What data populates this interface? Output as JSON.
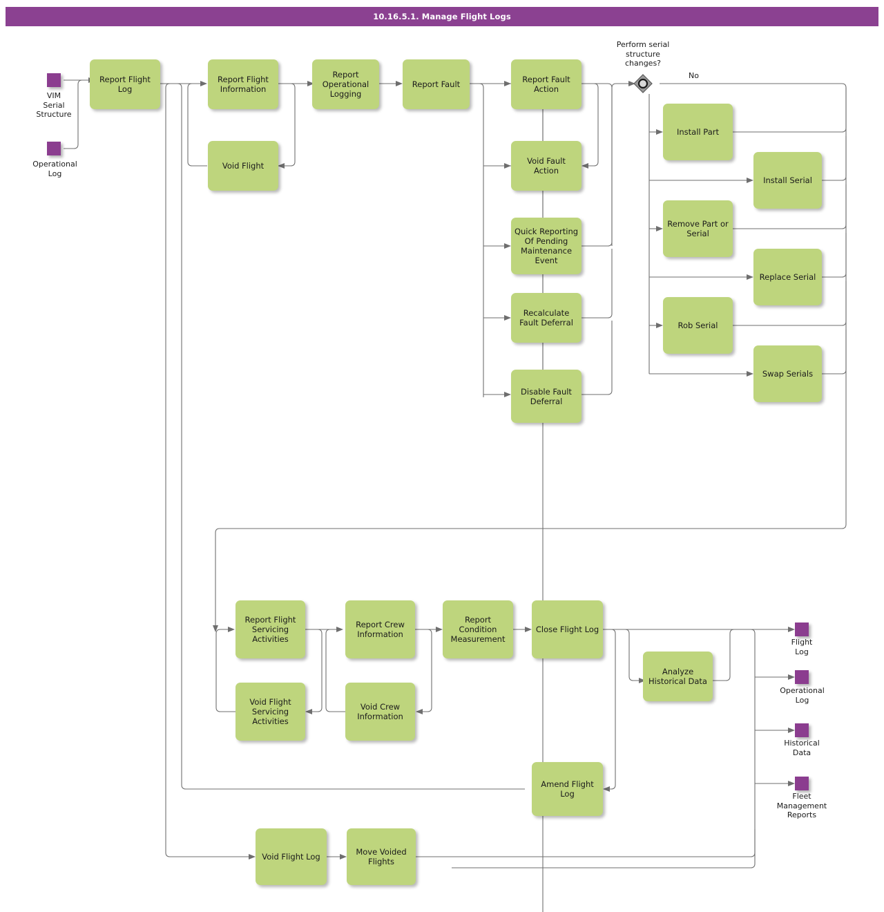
{
  "header": {
    "title": "10.16.5.1. Manage Flight Logs"
  },
  "colors": {
    "title_bar": "#8b4191",
    "process_box": "#bed57d",
    "terminator": "#8b3d8f",
    "connector": "#6e6e6e",
    "gateway_fill": "#8a8a8a"
  },
  "diagram": {
    "type": "flowchart",
    "terminators": [
      {
        "id": "t-vim-serial-structure",
        "label": "VIM\nSerial\nStructure",
        "label_lines": [
          "VIM",
          "Serial",
          "Structure"
        ]
      },
      {
        "id": "t-operational-log-in",
        "label": "Operational\nLog",
        "label_lines": [
          "Operational",
          "Log"
        ]
      },
      {
        "id": "t-flight-log-out",
        "label": "Flight\nLog",
        "label_lines": [
          "Flight",
          "Log"
        ]
      },
      {
        "id": "t-operational-log-out",
        "label": "Operational\nLog",
        "label_lines": [
          "Operational",
          "Log"
        ]
      },
      {
        "id": "t-historical-data-out",
        "label": "Historical\nData",
        "label_lines": [
          "Historical",
          "Data"
        ]
      },
      {
        "id": "t-fleet-management-reports-out",
        "label": "Fleet\nManagement\nReports",
        "label_lines": [
          "Fleet",
          "Management",
          "Reports"
        ]
      }
    ],
    "gateway": {
      "id": "gw-perform-serial-structure-changes",
      "question": "Perform serial structure changes?",
      "question_lines": [
        "Perform serial",
        "structure",
        "changes?"
      ],
      "branch_label_no": "No"
    },
    "nodes": [
      {
        "id": "n-report-flight-log",
        "label": "Report Flight Log"
      },
      {
        "id": "n-report-flight-information",
        "label": "Report Flight Information"
      },
      {
        "id": "n-void-flight",
        "label": "Void Flight"
      },
      {
        "id": "n-report-operational-logging",
        "label": "Report Operational Logging"
      },
      {
        "id": "n-report-fault",
        "label": "Report Fault"
      },
      {
        "id": "n-report-fault-action",
        "label": "Report Fault Action"
      },
      {
        "id": "n-void-fault-action",
        "label": "Void Fault Action"
      },
      {
        "id": "n-quick-reporting-of-pending-maintenance-event",
        "label": "Quick Reporting Of Pending Maintenance Event"
      },
      {
        "id": "n-recalculate-fault-deferral",
        "label": "Recalculate Fault Deferral"
      },
      {
        "id": "n-disable-fault-deferral",
        "label": "Disable Fault Deferral"
      },
      {
        "id": "n-install-part",
        "label": "Install Part"
      },
      {
        "id": "n-install-serial",
        "label": "Install Serial"
      },
      {
        "id": "n-remove-part-or-serial",
        "label": "Remove Part or Serial"
      },
      {
        "id": "n-replace-serial",
        "label": "Replace Serial"
      },
      {
        "id": "n-rob-serial",
        "label": "Rob Serial"
      },
      {
        "id": "n-swap-serials",
        "label": "Swap Serials"
      },
      {
        "id": "n-report-flight-servicing-activities",
        "label": "Report Flight Servicing Activities"
      },
      {
        "id": "n-void-flight-servicing-activities",
        "label": "Void Flight Servicing Activities"
      },
      {
        "id": "n-report-crew-information",
        "label": "Report Crew Information"
      },
      {
        "id": "n-void-crew-information",
        "label": "Void Crew Information"
      },
      {
        "id": "n-report-condition-measurement",
        "label": "Report Condition Measurement"
      },
      {
        "id": "n-close-flight-log",
        "label": "Close Flight Log"
      },
      {
        "id": "n-analyze-historical-data",
        "label": "Analyze Historical Data"
      },
      {
        "id": "n-amend-flight-log",
        "label": "Amend Flight Log"
      },
      {
        "id": "n-void-flight-log",
        "label": "Void Flight Log"
      },
      {
        "id": "n-move-voided-flights",
        "label": "Move Voided Flights"
      }
    ]
  }
}
